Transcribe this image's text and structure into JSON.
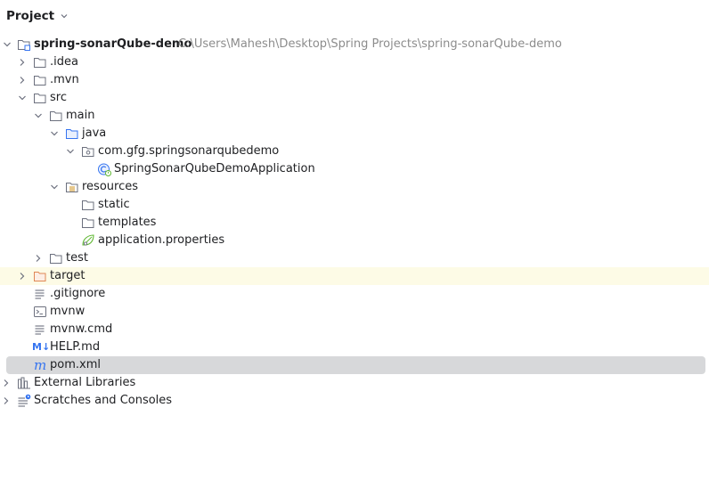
{
  "panel": {
    "title": "Project"
  },
  "tree": {
    "root": {
      "name": "spring-sonarQube-demo",
      "path": "C:\\Users\\Mahesh\\Desktop\\Spring Projects\\spring-sonarQube-demo"
    },
    "idea": ".idea",
    "mvn": ".mvn",
    "src": "src",
    "main": "main",
    "java": "java",
    "package": "com.gfg.springsonarqubedemo",
    "app_class": "SpringSonarQubeDemoApplication",
    "resources": "resources",
    "static": "static",
    "templates": "templates",
    "app_props": "application.properties",
    "test": "test",
    "target": "target",
    "gitignore": ".gitignore",
    "mvnw": "mvnw",
    "mvnw_cmd": "mvnw.cmd",
    "help": "HELP.md",
    "pom": "pom.xml",
    "external_libraries": "External Libraries",
    "scratches": "Scratches and Consoles"
  },
  "icons": {
    "markdown_glyph": "M↓",
    "maven_glyph": "m"
  },
  "colors": {
    "selection": "#d7d8da",
    "excluded_highlight": "#fdfbe6",
    "folder_stroke": "#6c707e",
    "source_folder": "#3574f0",
    "excluded_folder": "#e08855",
    "spring_green": "#5fb832",
    "path_gray": "#8c8c8c"
  }
}
